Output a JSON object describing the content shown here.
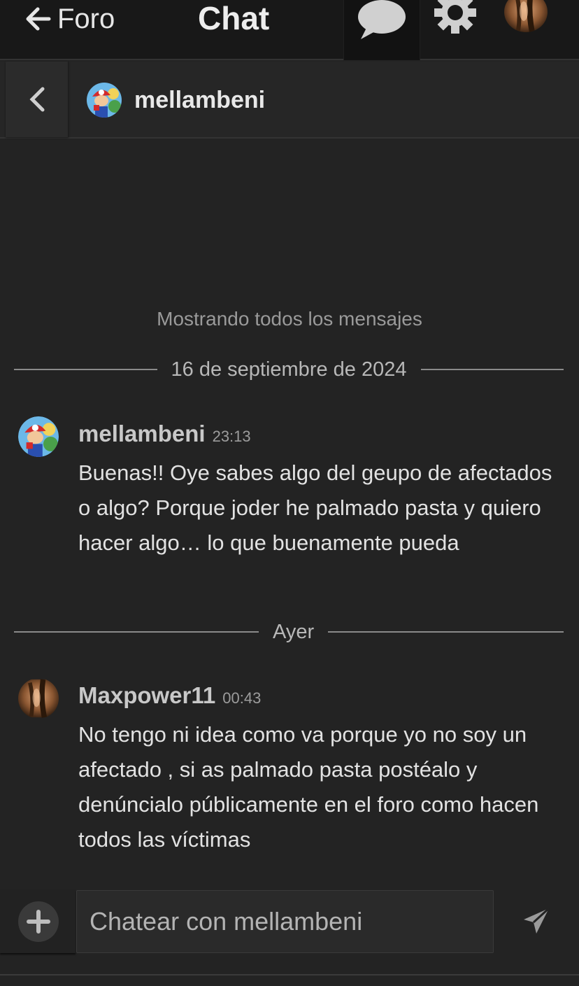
{
  "topbar": {
    "back_label": "Foro",
    "title": "Chat",
    "icons": [
      "arrow-left-icon",
      "speech-bubble-icon",
      "gear-icon",
      "avatar"
    ]
  },
  "conversation": {
    "name": "mellambeni"
  },
  "thread": {
    "info": "Mostrando todos los mensajes",
    "dividers": [
      "16 de septiembre de 2024",
      "Ayer"
    ],
    "messages": [
      {
        "author": "mellambeni",
        "time": "23:13",
        "text": "Buenas!! Oye sabes algo del geupo de afectados o algo? Porque joder he palmado pasta y quiero hacer algo… lo que buenamente pueda"
      },
      {
        "author": "Maxpower11",
        "time": "00:43",
        "text": "No tengo ni idea como va porque yo no soy un afectado , si as palmado pasta postéalo y denúncialo públicamente en el foro como hacen todos las víctimas"
      }
    ]
  },
  "composer": {
    "placeholder": "Chatear con mellambeni",
    "icons": [
      "plus-icon",
      "send-icon"
    ]
  },
  "colors": {
    "background": "#232323",
    "topbar": "#181818",
    "text": "#e2e2e2",
    "muted": "#9a9a9a"
  }
}
